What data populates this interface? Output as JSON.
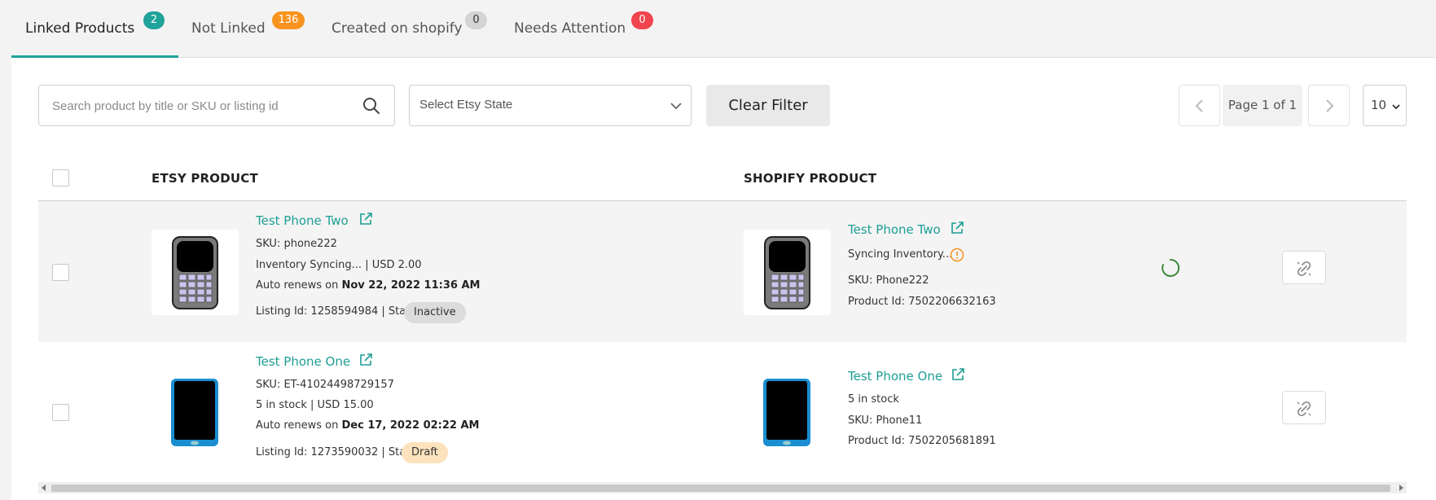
{
  "tabs": [
    {
      "label": "Linked Products",
      "count": "2",
      "color": "#20a39a"
    },
    {
      "label": "Not Linked",
      "count": "136",
      "color": "#f7931e"
    },
    {
      "label": "Created on shopify",
      "count": "0",
      "color": "#d4d4d4"
    },
    {
      "label": "Needs Attention",
      "count": "0",
      "color": "#f0444e"
    }
  ],
  "filters": {
    "search_placeholder": "Search product by title or SKU or listing id",
    "state_select": "Select Etsy State",
    "clear_button": "Clear Filter",
    "page_label": "Page 1 of 1",
    "per_page": "10"
  },
  "table": {
    "headers": {
      "etsy": "ETSY PRODUCT",
      "shopify": "SHOPIFY PRODUCT"
    },
    "rows": [
      {
        "etsy": {
          "title": "Test Phone Two",
          "sku": "SKU: phone222",
          "stock": "Inventory Syncing... | USD 2.00",
          "renews_prefix": "Auto renews on ",
          "renews_date": "Nov 22, 2022 11:36 AM",
          "listing": "Listing Id: 1258594984 | State:",
          "state": "Inactive"
        },
        "shopify": {
          "title": "Test Phone Two",
          "status": "Syncing Inventory...",
          "sku": "SKU: Phone222",
          "product_id": "Product Id: 7502206632163"
        },
        "icon": "keypad-phone"
      },
      {
        "etsy": {
          "title": "Test Phone One",
          "sku": "SKU: ET-41024498729157",
          "stock": "5 in stock | USD 15.00",
          "renews_prefix": "Auto renews on ",
          "renews_date": "Dec 17, 2022 02:22 AM",
          "listing": "Listing Id: 1273590032 | State:",
          "state": "Draft"
        },
        "shopify": {
          "title": "Test Phone One",
          "stock": "5 in stock",
          "sku": "SKU: Phone11",
          "product_id": "Product Id: 7502205681891"
        },
        "icon": "smartphone"
      }
    ]
  },
  "colors": {
    "accent": "#20a39a",
    "inactive_pill": "#dcdcdc",
    "draft_pill": "#fde3bd",
    "warning": "#f7931e"
  }
}
